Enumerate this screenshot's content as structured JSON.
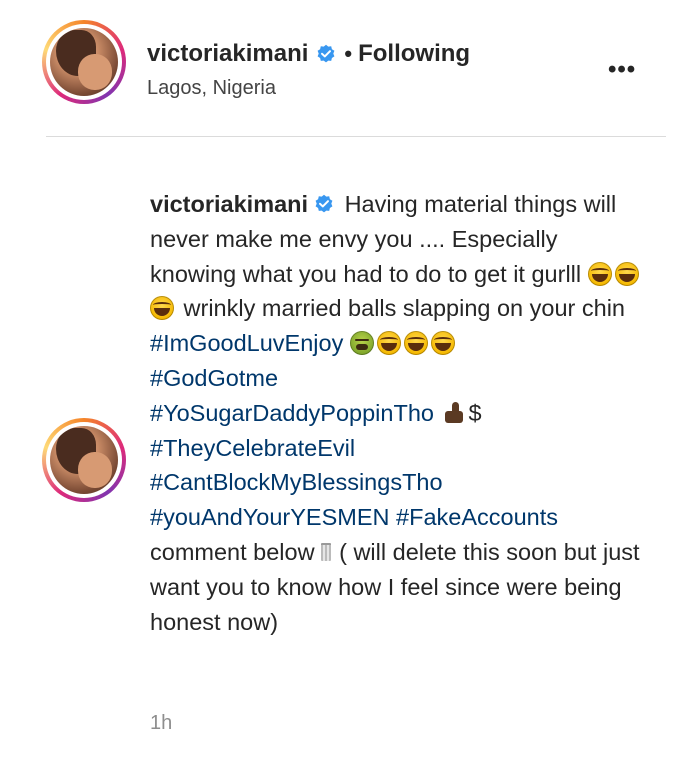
{
  "post": {
    "username": "victoriakimani",
    "separator": "•",
    "follow_status": "Following",
    "location": "Lagos, Nigeria",
    "more_label": "•••",
    "verified_icon": "verified-badge-icon",
    "accent_color": "#3897f0"
  },
  "caption": {
    "username": "victoriakimani",
    "text_1": "Having material things will never make me envy you .... Especially knowing what you had to do to get it gurlll",
    "text_2": "wrinkly married balls slapping on your chin",
    "hashtag_1": "#ImGoodLuvEnjoy",
    "hashtag_2": "#GodGotme",
    "hashtag_3": "#YoSugarDaddyPoppinTho",
    "dollar": "$",
    "hashtag_4": "#TheyCelebrateEvil",
    "hashtag_5": "#CantBlockMyBlessingsTho",
    "hashtag_6": "#youAndYourYESMEN",
    "hashtag_7": "#FakeAccounts",
    "text_3": "comment below",
    "text_4": "( will delete this soon but just want you to know how I feel since were being honest now)",
    "hashtag_color": "#00376b"
  },
  "timestamp": "1h"
}
